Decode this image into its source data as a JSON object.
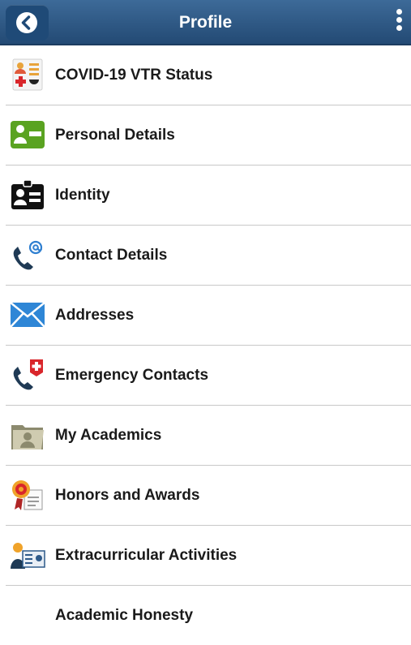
{
  "header": {
    "title": "Profile",
    "back_icon": "chevron-left-icon",
    "menu_icon": "more-vertical-icon",
    "bar_color": "#2d5886"
  },
  "items": [
    {
      "label": "COVID-19 VTR Status",
      "icon": "covid-status-icon"
    },
    {
      "label": "Personal Details",
      "icon": "id-card-icon"
    },
    {
      "label": "Identity",
      "icon": "identity-badge-icon"
    },
    {
      "label": "Contact Details",
      "icon": "phone-email-icon"
    },
    {
      "label": "Addresses",
      "icon": "envelope-icon"
    },
    {
      "label": "Emergency Contacts",
      "icon": "phone-emergency-icon"
    },
    {
      "label": "My Academics",
      "icon": "folder-person-icon"
    },
    {
      "label": "Honors and Awards",
      "icon": "award-ribbon-icon"
    },
    {
      "label": "Extracurricular Activities",
      "icon": "presentation-person-icon"
    },
    {
      "label": "Academic Honesty",
      "icon": ""
    }
  ]
}
